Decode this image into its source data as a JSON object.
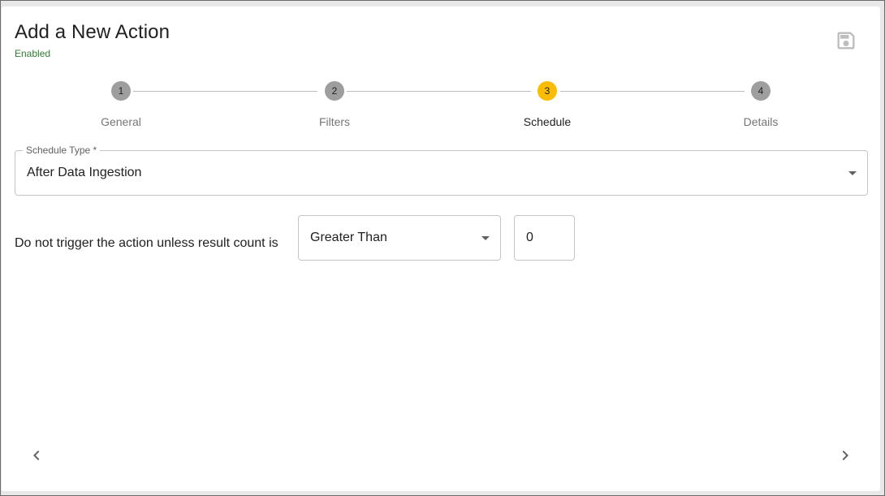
{
  "header": {
    "title": "Add a New Action",
    "status": "Enabled",
    "save_icon": "save-icon"
  },
  "stepper": {
    "steps": [
      {
        "number": "1",
        "label": "General",
        "state": "inactive"
      },
      {
        "number": "2",
        "label": "Filters",
        "state": "inactive"
      },
      {
        "number": "3",
        "label": "Schedule",
        "state": "active"
      },
      {
        "number": "4",
        "label": "Details",
        "state": "inactive"
      }
    ]
  },
  "schedule": {
    "label": "Schedule Type *",
    "value": "After Data Ingestion"
  },
  "trigger": {
    "label": "Do not trigger the action unless result count is",
    "comparator": "Greater Than",
    "count": "0"
  },
  "nav": {
    "prev_icon": "chevron-left-icon",
    "next_icon": "chevron-right-icon"
  },
  "colors": {
    "active_step": "#fbbc05",
    "inactive_step": "#9e9e9e",
    "status": "#2e7d32"
  }
}
